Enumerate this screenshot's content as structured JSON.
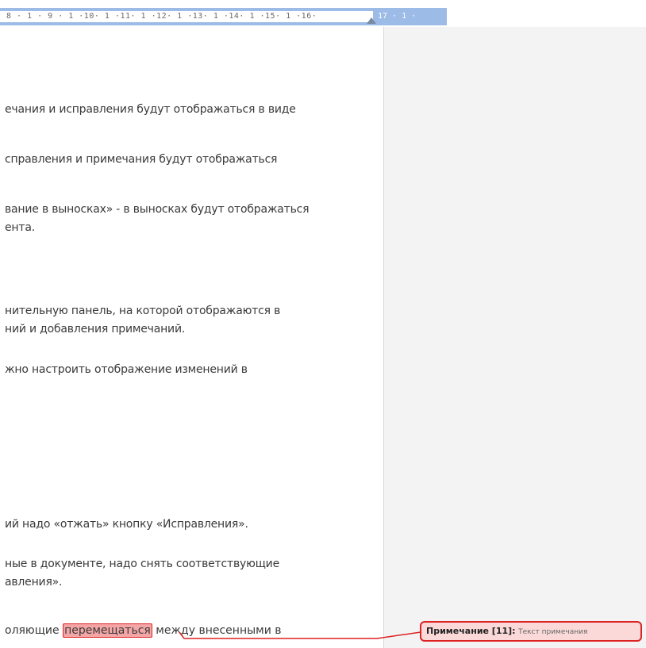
{
  "ruler": {
    "ticks": "8 · 1 · 9 · 1 ·10· 1 ·11· 1 ·12· 1 ·13· 1 ·14· 1 ·15· 1 ·16·",
    "ticks_right": "17 · 1 ·"
  },
  "document": {
    "lines": [
      "ечания и исправления будут отображаться в виде",
      "справления и примечания будут отображаться",
      "вание в выносках» - в выносках будут отображаться",
      "ента.",
      "нительную панель, на которой отображаются в",
      "ний и добавления примечаний.",
      "жно настроить отображение изменений в",
      "ий надо «отжать» кнопку «Исправления».",
      "ные в документе, надо снять соответствующие",
      "авления»."
    ],
    "last_line_before": "оляющие ",
    "highlighted_word": "перемещаться",
    "last_line_after": " между внесенными в"
  },
  "comment": {
    "label": "Примечание [11]:",
    "text": "Текст примечания"
  },
  "colors": {
    "ruler_blue": "#9cbbe6",
    "comment_border": "#dd2222",
    "highlight_fill": "#f4a6a6"
  }
}
